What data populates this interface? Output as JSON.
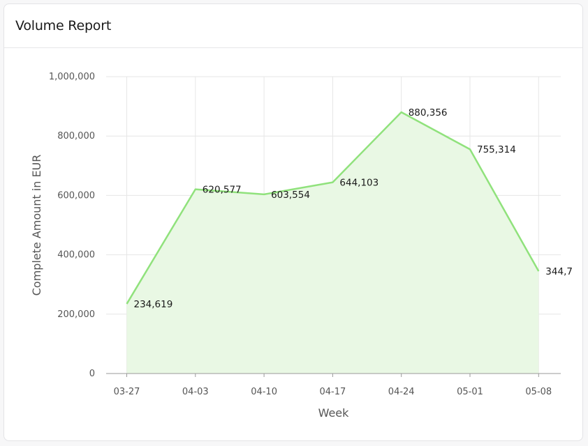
{
  "card": {
    "title": "Volume Report"
  },
  "colors": {
    "line": "#90e27c",
    "area": "#e9f8e4",
    "grid": "#e6e6e6",
    "axis_text": "#555555",
    "label_text": "#1a1a1a"
  },
  "chart_data": {
    "type": "area",
    "title": "Volume Report",
    "xlabel": "Week",
    "ylabel": "Complete Amount in EUR",
    "ylim": [
      0,
      1000000
    ],
    "y_ticks": [
      0,
      200000,
      400000,
      600000,
      800000,
      1000000
    ],
    "y_tick_labels": [
      "0",
      "200,000",
      "400,000",
      "600,000",
      "800,000",
      "1,000,000"
    ],
    "grid": true,
    "x": [
      "03-27",
      "04-03",
      "04-10",
      "04-17",
      "04-24",
      "05-01",
      "05-08"
    ],
    "values": [
      234619,
      620577,
      603554,
      644103,
      880356,
      755314,
      344700
    ],
    "data_labels": [
      "234,619",
      "620,577",
      "603,554",
      "644,103",
      "880,356",
      "755,314",
      "344,7"
    ]
  }
}
